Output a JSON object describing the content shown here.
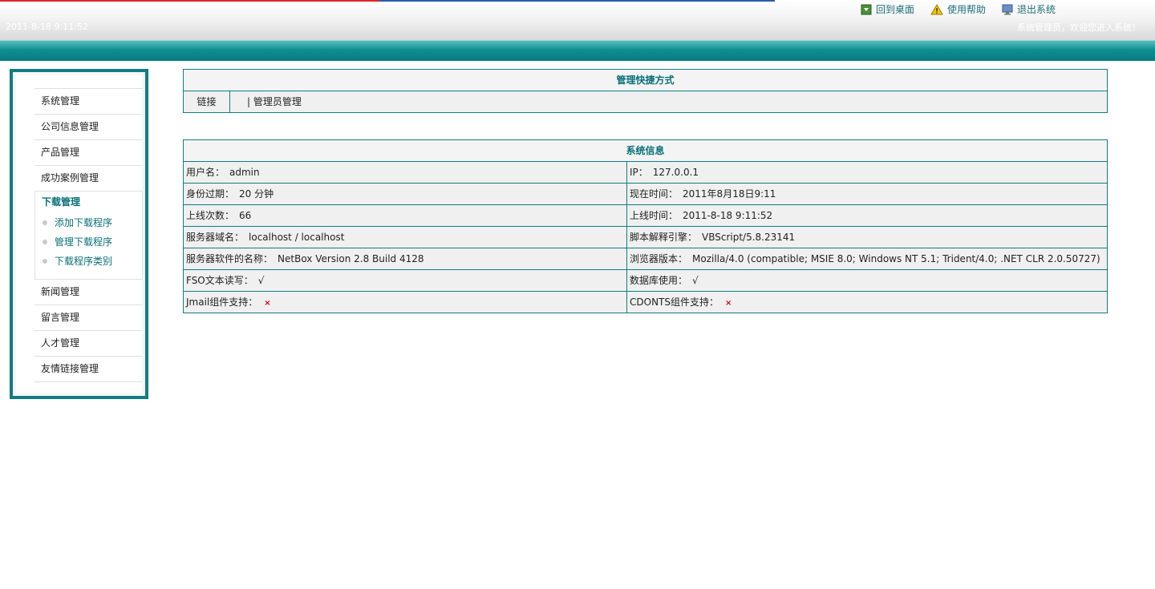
{
  "header": {
    "datetime": "2011-8-18 9:11:52",
    "links": [
      {
        "label": "回到桌面",
        "icon": "desktop-icon"
      },
      {
        "label": "使用帮助",
        "icon": "warning-icon"
      },
      {
        "label": "退出系统",
        "icon": "monitor-icon"
      }
    ],
    "welcome": "系统管理员，欢迎您进入系统！"
  },
  "sidebar": {
    "items_top": [
      "系统管理",
      "公司信息管理",
      "产品管理",
      "成功案例管理"
    ],
    "group": {
      "title": "下载管理",
      "items": [
        "添加下载程序",
        "管理下载程序",
        "下载程序类别"
      ]
    },
    "items_bottom": [
      "新闻管理",
      "留言管理",
      "人才管理",
      "友情链接管理"
    ]
  },
  "quick": {
    "title": "管理快捷方式",
    "label": "链接",
    "link": "| 管理员管理"
  },
  "sysinfo": {
    "title": "系统信息",
    "rows": [
      {
        "l_label": "用户名：",
        "l_value": "admin",
        "r_label": "IP：",
        "r_value": "127.0.0.1"
      },
      {
        "l_label": "身份过期：",
        "l_value": "20 分钟",
        "r_label": "现在时间：",
        "r_value": "2011年8月18日9:11"
      },
      {
        "l_label": "上线次数：",
        "l_value": "66",
        "r_label": "上线时间：",
        "r_value": "2011-8-18 9:11:52"
      },
      {
        "l_label": "服务器域名：",
        "l_value": "localhost / localhost",
        "r_label": "脚本解释引擎：",
        "r_value": "VBScript/5.8.23141"
      },
      {
        "l_label": "服务器软件的名称：",
        "l_value": "NetBox Version 2.8 Build 4128",
        "r_label": "浏览器版本：",
        "r_value": "Mozilla/4.0 (compatible; MSIE 8.0; Windows NT 5.1; Trident/4.0; .NET CLR 2.0.50727)"
      },
      {
        "l_label": "FSO文本读写：",
        "l_value": "√",
        "r_label": "数据库使用：",
        "r_value": "√"
      },
      {
        "l_label": "Jmail组件支持：",
        "l_value": "×",
        "r_label": "CDONTS组件支持：",
        "r_value": "×"
      }
    ]
  },
  "colors": {
    "accent": "#127c82",
    "link": "#08707a",
    "cross": "#d0021b"
  }
}
